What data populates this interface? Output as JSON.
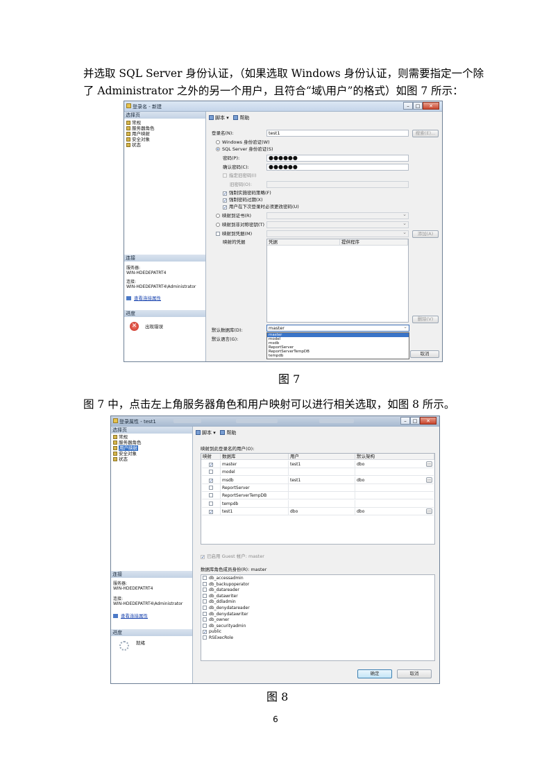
{
  "paragraphs": [
    "并选取 SQL Server 身份认证，（如果选取 Windows 身份认证，则需要指定一个除",
    "了 Administrator 之外的另一个用户，且符合“域\\用户”的格式）如图 7 所示：",
    "图 7 中，点击左上角服务器角色和用户映射可以进行相关选取，如图 8 所示。"
  ],
  "captions": {
    "fig7": "图 7",
    "fig8": "图 8"
  },
  "page_number": "6",
  "fig7": {
    "title": "登录名 - 新建",
    "sidebar": {
      "header": "选择页",
      "items": [
        "常规",
        "服务器角色",
        "用户映射",
        "安全对象",
        "状态"
      ],
      "connection_header": "连接",
      "server_label": "服务器:",
      "server_value": "WIN-HDEDEPATRT4",
      "conn_label": "连接:",
      "conn_value": "WIN-HDEDEPATRT4\\Administrator",
      "view_link": "查看连接属性",
      "progress_header": "进度",
      "progress_status": "出现错误"
    },
    "toolbar": {
      "script": "脚本",
      "help": "帮助"
    },
    "form": {
      "login_name_label": "登录名(N):",
      "login_name_value": "test1",
      "search_button": "搜索(E)...",
      "windows_auth": "Windows 身份验证(W)",
      "sql_auth": "SQL Server 身份验证(S)",
      "password_label": "密码(P):",
      "password_value": "●●●●●●",
      "confirm_label": "确认密码(C):",
      "confirm_value": "●●●●●●",
      "old_password_check": "指定旧密码(I)",
      "old_password_label": "旧密码(O):",
      "enforce_policy": "强制实施密码策略(F)",
      "enforce_expiration": "强制密码过期(X)",
      "must_change": "用户在下次登录时必须更改密码(U)",
      "cert_mapping": "映射到证书(R)",
      "asym_key_mapping": "映射到非对称密钥(T)",
      "credential_mapping": "映射到凭据(M)",
      "add_button": "添加(A)",
      "mapped_credentials": "映射的凭据",
      "col_credential": "凭据",
      "col_provider": "提供程序",
      "remove_button": "删除(V)",
      "default_db_label": "默认数据库(D):",
      "default_db_value": "master",
      "default_lang_label": "默认语言(G):",
      "cancel_button": "取消",
      "db_options": [
        "master",
        "model",
        "msdb",
        "ReportServer",
        "ReportServerTempDB",
        "tempdb"
      ]
    }
  },
  "fig8": {
    "title": "登录属性 - test1",
    "sidebar": {
      "header": "选择页",
      "items": [
        "常规",
        "服务器角色",
        "用户映射",
        "安全对象",
        "状态"
      ],
      "connection_header": "连接",
      "server_label": "服务器:",
      "server_value": "WIN-HDEDEPATRT4",
      "conn_label": "连接:",
      "conn_value": "WIN-HDEDEPATRT4\\Administrator",
      "view_link": "查看连接属性",
      "progress_header": "进度",
      "progress_status": "就绪"
    },
    "toolbar": {
      "script": "脚本",
      "help": "帮助"
    },
    "mapped_label": "映射到此登录名的用户(O):",
    "columns": [
      "映射",
      "数据库",
      "用户",
      "默认架构"
    ],
    "rows": [
      {
        "checked": true,
        "db": "master",
        "user": "test1",
        "schema": "dbo",
        "button": true
      },
      {
        "checked": false,
        "db": "model",
        "user": "",
        "schema": "",
        "button": false
      },
      {
        "checked": true,
        "db": "msdb",
        "user": "test1",
        "schema": "dbo",
        "button": true
      },
      {
        "checked": false,
        "db": "ReportServer",
        "user": "",
        "schema": "",
        "button": false
      },
      {
        "checked": false,
        "db": "ReportServerTempDB",
        "user": "",
        "schema": "",
        "button": false
      },
      {
        "checked": false,
        "db": "tempdb",
        "user": "",
        "schema": "",
        "button": false
      },
      {
        "checked": true,
        "db": "test1",
        "user": "dbo",
        "schema": "dbo",
        "button": true
      }
    ],
    "guest_label": "已启用 Guest 帐户: master",
    "role_label": "数据库角色成员身份(R): master",
    "roles": [
      {
        "name": "db_accessadmin",
        "checked": false
      },
      {
        "name": "db_backupoperator",
        "checked": false
      },
      {
        "name": "db_datareader",
        "checked": false
      },
      {
        "name": "db_datawriter",
        "checked": false
      },
      {
        "name": "db_ddladmin",
        "checked": false
      },
      {
        "name": "db_denydatareader",
        "checked": false
      },
      {
        "name": "db_denydatawriter",
        "checked": false
      },
      {
        "name": "db_owner",
        "checked": false
      },
      {
        "name": "db_securityadmin",
        "checked": false
      },
      {
        "name": "public",
        "checked": true
      },
      {
        "name": "RSExecRole",
        "checked": false
      }
    ],
    "ok_button": "确定",
    "cancel_button": "取消"
  }
}
